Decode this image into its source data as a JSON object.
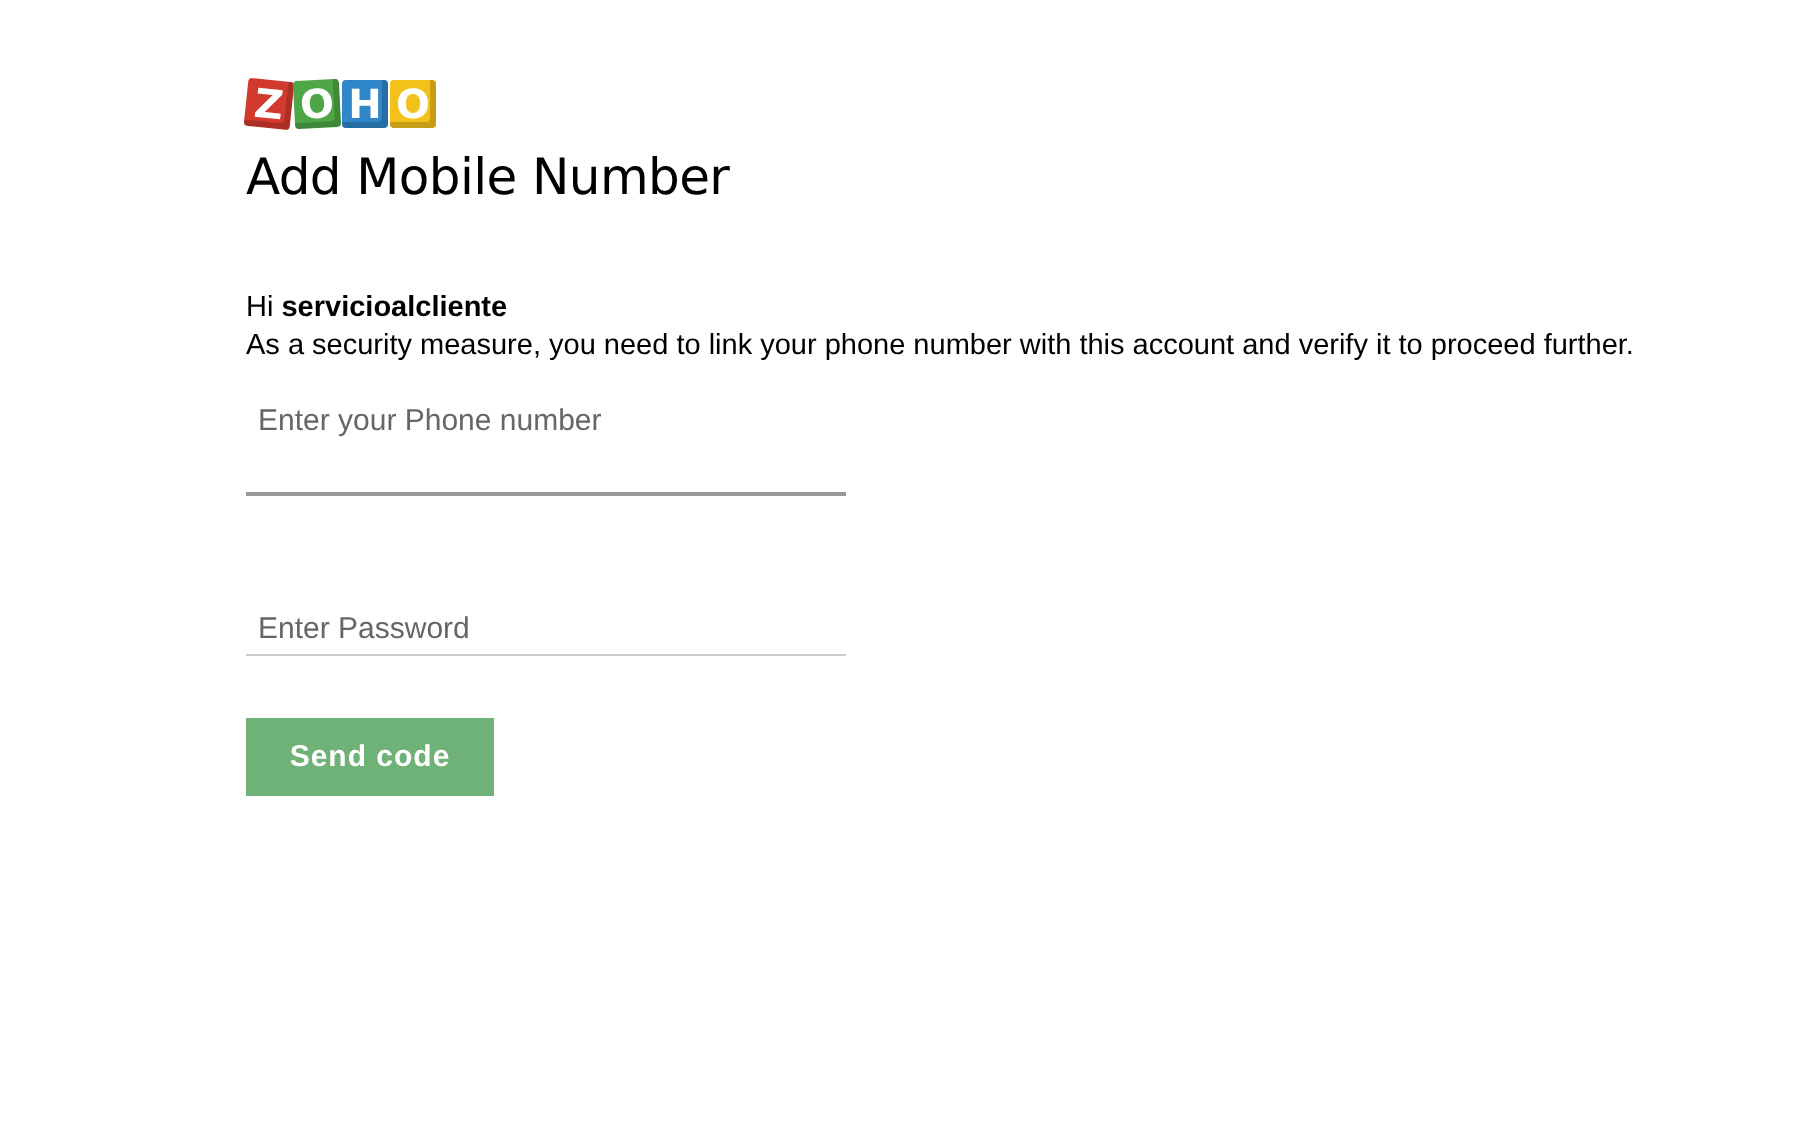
{
  "logo": {
    "letters": [
      {
        "char": "Z",
        "color": "#d23a2e"
      },
      {
        "char": "O",
        "color": "#4ea646"
      },
      {
        "char": "H",
        "color": "#2f86c9"
      },
      {
        "char": "O",
        "color": "#f2c21b"
      }
    ]
  },
  "title": "Add Mobile Number",
  "greeting": "Hi **servicioalcliente**",
  "message": "As a security measure, you need to link your phone number with this account and verify it to proceed further.",
  "fields": [
    {
      "placeholder": "Enter your Phone number",
      "kind": "tall",
      "focused": true
    },
    {
      "placeholder": "Enter Password",
      "kind": "password",
      "focused": false
    }
  ],
  "button": "Send code"
}
